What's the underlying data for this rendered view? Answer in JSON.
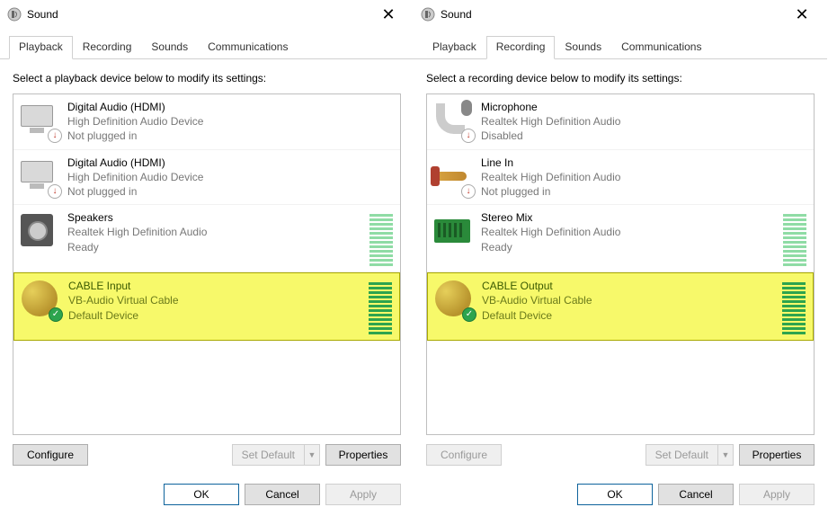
{
  "left": {
    "title": "Sound",
    "tabs": [
      "Playback",
      "Recording",
      "Sounds",
      "Communications"
    ],
    "active_tab": 0,
    "instruction": "Select a playback device below to modify its settings:",
    "devices": [
      {
        "name": "Digital Audio (HDMI)",
        "desc": "High Definition Audio Device",
        "status": "Not plugged in",
        "icon": "monitor",
        "badge": "down"
      },
      {
        "name": "Digital Audio (HDMI)",
        "desc": "High Definition Audio Device",
        "status": "Not plugged in",
        "icon": "monitor",
        "badge": "down"
      },
      {
        "name": "Speakers",
        "desc": "Realtek High Definition Audio",
        "status": "Ready",
        "icon": "speaker",
        "badge": "",
        "meter": "faded"
      },
      {
        "name": "CABLE Input",
        "desc": "VB-Audio Virtual Cable",
        "status": "Default Device",
        "icon": "cable",
        "badge": "green",
        "highlight": true,
        "meter": "on"
      }
    ],
    "buttons": {
      "configure": "Configure",
      "setdefault": "Set Default",
      "properties": "Properties"
    },
    "footer": {
      "ok": "OK",
      "cancel": "Cancel",
      "apply": "Apply"
    }
  },
  "right": {
    "title": "Sound",
    "tabs": [
      "Playback",
      "Recording",
      "Sounds",
      "Communications"
    ],
    "active_tab": 1,
    "instruction": "Select a recording device below to modify its settings:",
    "devices": [
      {
        "name": "Microphone",
        "desc": "Realtek High Definition Audio",
        "status": "Disabled",
        "icon": "mic",
        "badge": "down"
      },
      {
        "name": "Line In",
        "desc": "Realtek High Definition Audio",
        "status": "Not plugged in",
        "icon": "jack",
        "badge": "down"
      },
      {
        "name": "Stereo Mix",
        "desc": "Realtek High Definition Audio",
        "status": "Ready",
        "icon": "card",
        "badge": "",
        "meter": "faded"
      },
      {
        "name": "CABLE Output",
        "desc": "VB-Audio Virtual Cable",
        "status": "Default Device",
        "icon": "cable",
        "badge": "green",
        "highlight": true,
        "meter": "on"
      }
    ],
    "buttons": {
      "configure": "Configure",
      "setdefault": "Set Default",
      "properties": "Properties"
    },
    "footer": {
      "ok": "OK",
      "cancel": "Cancel",
      "apply": "Apply"
    }
  }
}
